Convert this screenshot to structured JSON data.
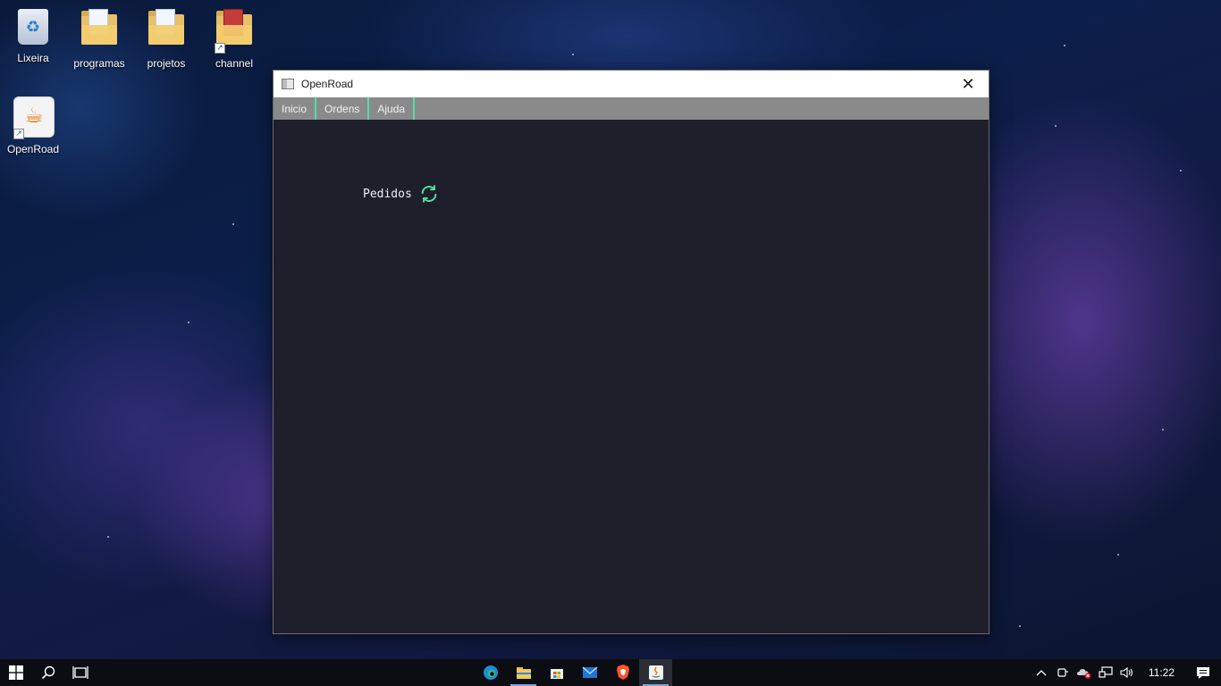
{
  "desktop": {
    "icons": [
      {
        "label": "Lixeira"
      },
      {
        "label": "programas"
      },
      {
        "label": "projetos"
      },
      {
        "label": "channel"
      },
      {
        "label": "OpenRoad"
      }
    ]
  },
  "window": {
    "title": "OpenRoad",
    "close_glyph": "✕",
    "menu": [
      "Inicio",
      "Ordens",
      "Ajuda"
    ],
    "accent_color": "#4fe0a0",
    "content": {
      "label": "Pedidos",
      "refresh_icon": "refresh-icon"
    }
  },
  "taskbar": {
    "apps": [
      "start-icon",
      "search-icon",
      "task-view-icon",
      "edge-icon",
      "file-explorer-icon",
      "store-icon",
      "mail-icon",
      "brave-icon",
      "java-app-icon"
    ],
    "tray": {
      "chevron": "^",
      "clock": "11:22"
    }
  }
}
